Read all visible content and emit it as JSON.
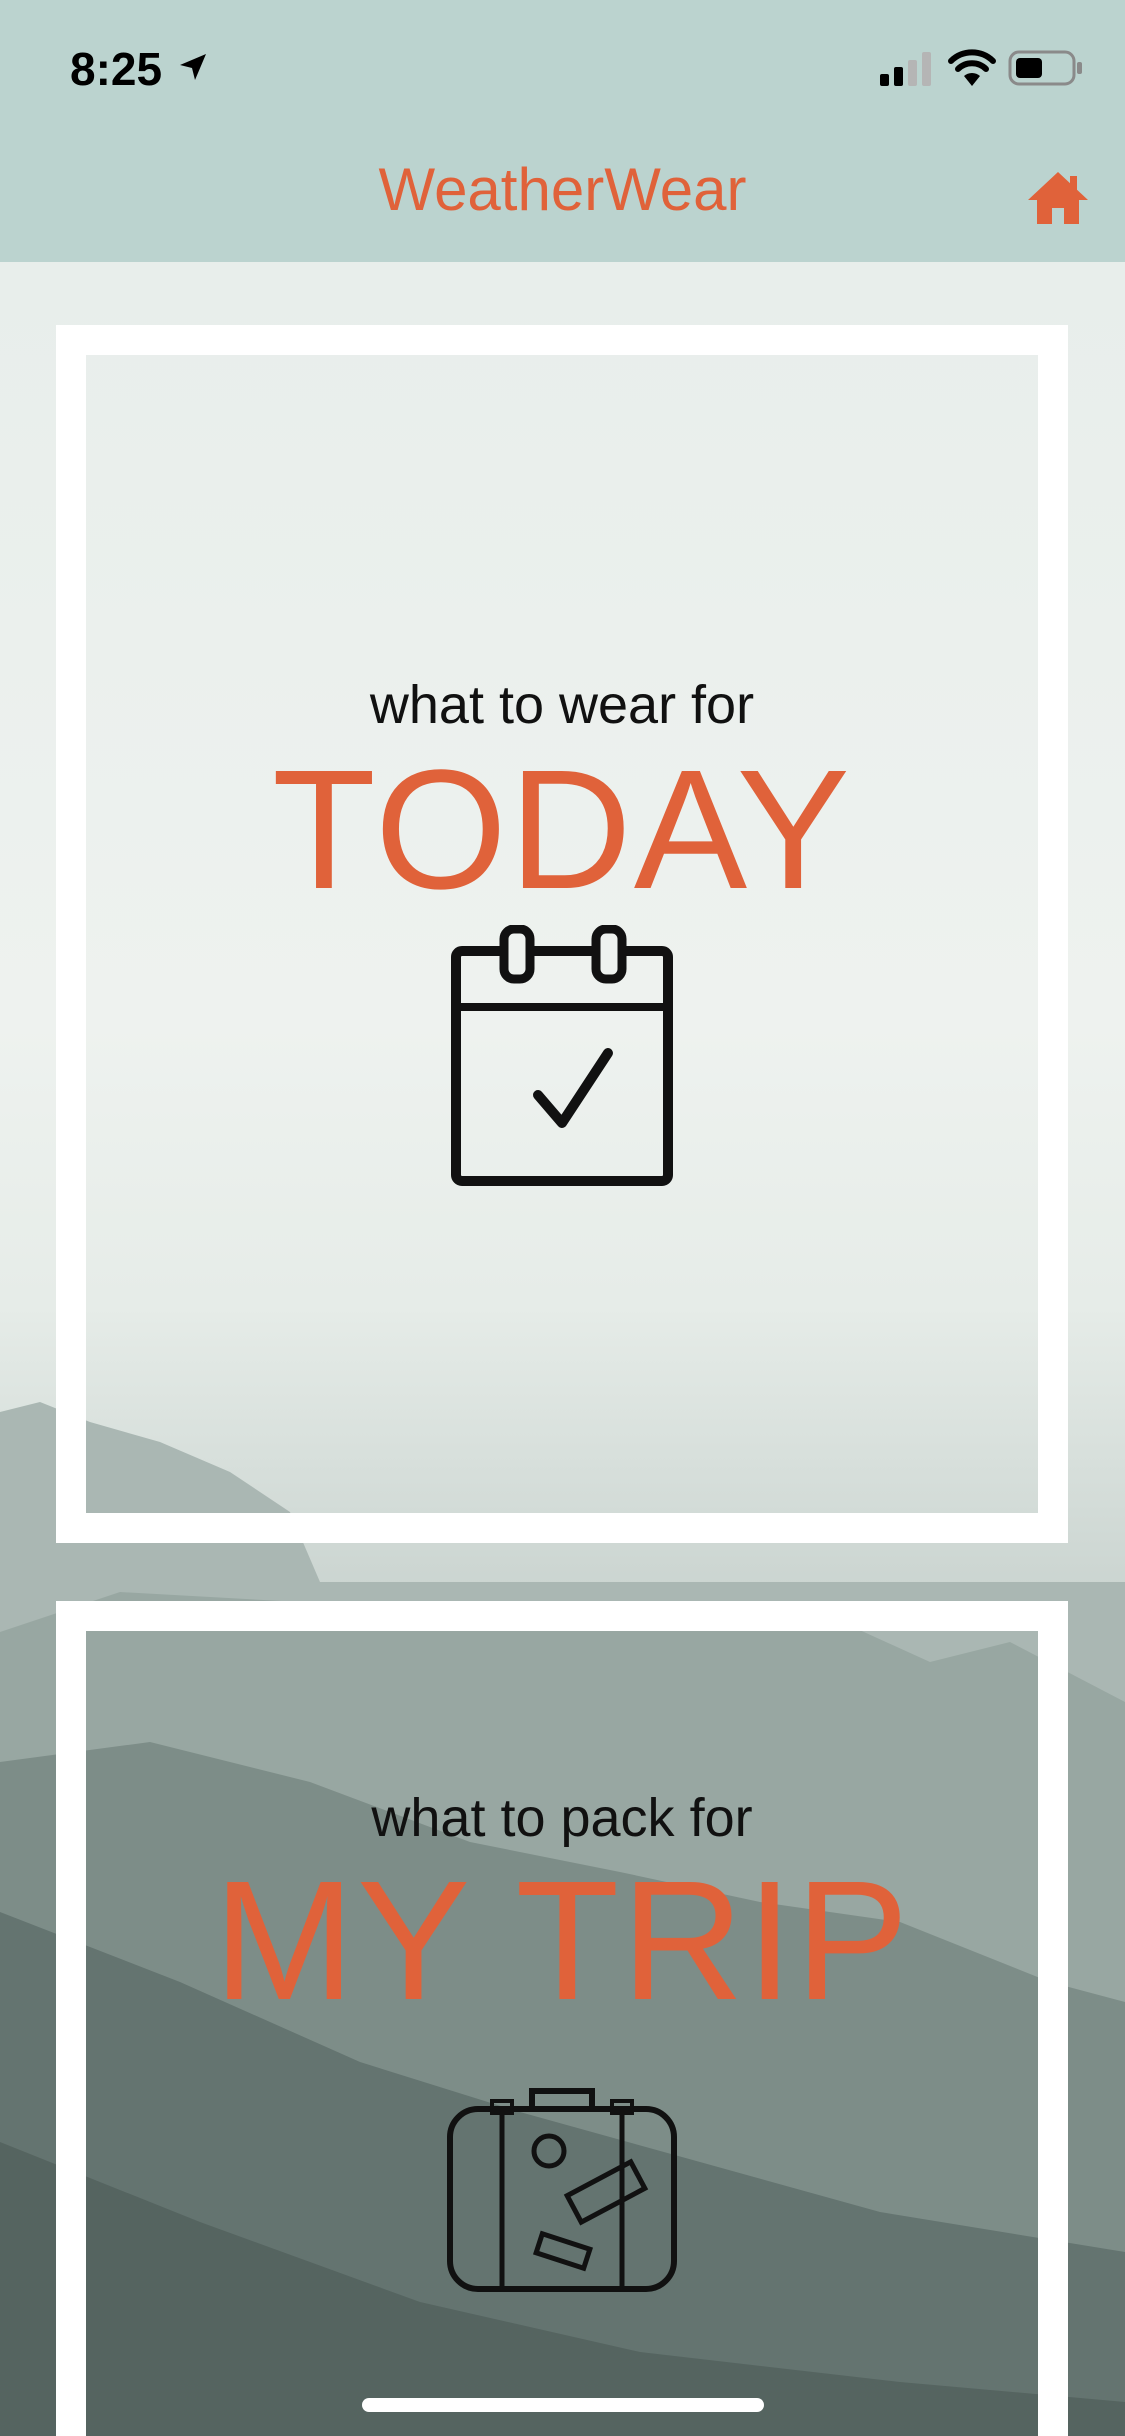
{
  "status_bar": {
    "time": "8:25",
    "icons": [
      "location-arrow-icon",
      "cellular-signal-icon",
      "wifi-icon",
      "battery-icon"
    ]
  },
  "nav": {
    "title": "WeatherWear",
    "home_icon": "home-icon"
  },
  "cards": [
    {
      "kicker": "what to wear for",
      "headline": "TODAY",
      "icon": "calendar-check-icon"
    },
    {
      "kicker": "what to pack for",
      "headline": "MY TRIP",
      "icon": "suitcase-icon"
    }
  ],
  "colors": {
    "accent": "#e0623a",
    "bar": "#bbd3cf",
    "card_border": "#ffffff",
    "text": "#111111"
  }
}
